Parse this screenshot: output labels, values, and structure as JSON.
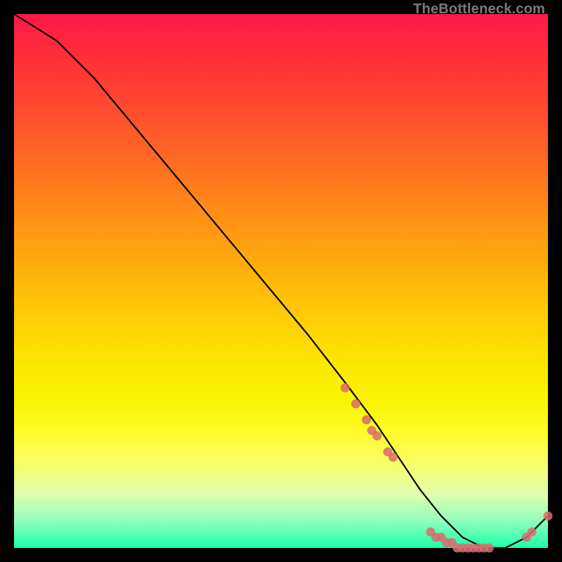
{
  "attribution": "TheBottleneck.com",
  "colors": {
    "dot": "#d86c6c",
    "line": "#000000",
    "frame": "#000000",
    "gradient_top": "#ff1848",
    "gradient_bottom": "#1affa8"
  },
  "chart_data": {
    "type": "line",
    "title": "",
    "xlabel": "",
    "ylabel": "",
    "xlim": [
      0,
      100
    ],
    "ylim": [
      0,
      100
    ],
    "x": [
      0,
      8,
      15,
      25,
      35,
      45,
      55,
      62,
      68,
      72,
      76,
      80,
      84,
      88,
      92,
      96,
      100
    ],
    "values": [
      100,
      95,
      88,
      76,
      64,
      52,
      40,
      31,
      23,
      17,
      11,
      6,
      2,
      0,
      0,
      2,
      6
    ],
    "points": {
      "type": "scatter",
      "x": [
        62,
        64,
        66,
        67,
        68,
        70,
        71,
        78,
        79,
        80,
        81,
        82,
        83,
        84,
        85,
        86,
        87,
        88,
        89,
        96,
        97,
        100
      ],
      "y": [
        30,
        27,
        24,
        22,
        21,
        18,
        17,
        3,
        2,
        2,
        1,
        1,
        0,
        0,
        0,
        0,
        0,
        0,
        0,
        2,
        3,
        6
      ]
    }
  }
}
